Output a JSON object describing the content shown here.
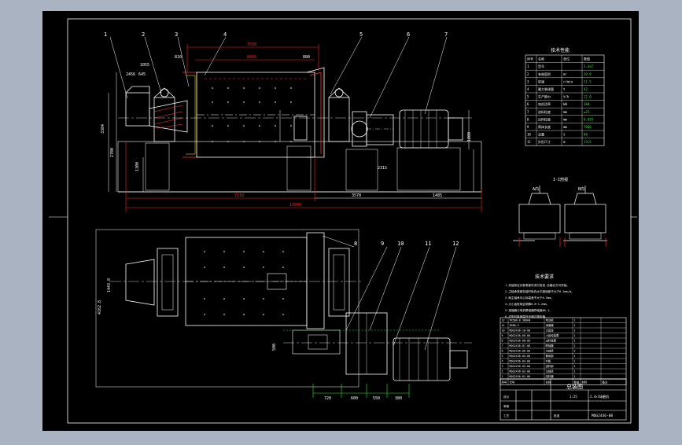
{
  "colors": {
    "viewport_bg": "#a9b3c2",
    "sheet_bg": "#000000",
    "line": "#ffffff",
    "red_dim": "#ff2020",
    "green_dim": "#22ee22",
    "yellow_text": "#ffff00",
    "cyan": "#00e5ff"
  },
  "callouts_top": [
    "1",
    "2",
    "3",
    "4",
    "5",
    "6",
    "7"
  ],
  "callouts_bottom": [
    "8",
    "9",
    "10",
    "11",
    "12"
  ],
  "dims_top": {
    "d7550": "7550",
    "d6800": "6800",
    "d7218": "7218",
    "d13090": "13090",
    "d3570": "3570",
    "d1485": "1485",
    "d1055": "1055",
    "d810": "810",
    "d880": "880",
    "d2315": "2315",
    "d1300": "1300",
    "d1000": "1000",
    "d3384": "3384",
    "d2700": "2700",
    "d645": "645",
    "d2456": "2456"
  },
  "dims_bottom": {
    "d4162": "4162.8",
    "d1443": "1443.8",
    "d500": "500",
    "d720": "720",
    "d600": "600",
    "d550": "550",
    "d380": "380"
  },
  "tech_table": {
    "title": "技术性能",
    "headers": [
      "序号",
      "名称",
      "单位",
      "数值"
    ],
    "rows": [
      [
        "1",
        "型号",
        "",
        "2.4×7"
      ],
      [
        "2",
        "有效容积",
        "m³",
        "28.9"
      ],
      [
        "3",
        "转速",
        "r/min",
        "21.5"
      ],
      [
        "4",
        "最大装球量",
        "t",
        "42"
      ],
      [
        "5",
        "生产能力",
        "t/h",
        "12.0"
      ],
      [
        "6",
        "电机功率",
        "kW",
        "380"
      ],
      [
        "7",
        "进料粒度",
        "mm",
        "≤25"
      ],
      [
        "8",
        "出料粒度",
        "mm",
        "0.074"
      ],
      [
        "9",
        "筒体长度",
        "mm",
        "7000"
      ],
      [
        "10",
        "总重",
        "t",
        "88"
      ],
      [
        "11",
        "外形尺寸",
        "m",
        "13×5"
      ]
    ]
  },
  "detail_label": "I-I剖视",
  "detail_marks": [
    "A向",
    "B向"
  ],
  "notes": {
    "title": "技术要求",
    "lines": [
      "1.安装前应对各零部件进行检查,合格后方可安装。",
      "2.主轴承底座安装时纵向水平度误差不大于0.1mm/m。",
      "3.两主轴承中心标高差不大于0.5mm。",
      "4.大小齿轮啮合侧隙0.8~1.2mm。",
      "5.减速器与电机联轴器同轴度Φ0.1。",
      "6.试车时各部温升不超过规定值。"
    ]
  },
  "parts_list": {
    "rows": [
      [
        "12",
        "YR500-8 380kW",
        "电动机",
        "1",
        "",
        ""
      ],
      [
        "11",
        "ZD80-5",
        "减速器",
        "1",
        "",
        ""
      ],
      [
        "10",
        "MQG2436-10-00",
        "大齿轮",
        "1",
        "",
        ""
      ],
      [
        "9",
        "MQG2436-09-00",
        "小齿轮装置",
        "1",
        "",
        ""
      ],
      [
        "8",
        "MQG2436-08-00",
        "出料装置",
        "1",
        "",
        ""
      ],
      [
        "7",
        "MQG2436-07-00",
        "联轴器",
        "1",
        "",
        ""
      ],
      [
        "6",
        "MQG2436-06-00",
        "主轴承",
        "2",
        "",
        ""
      ],
      [
        "5",
        "MQG2436-05-00",
        "筒体部",
        "1",
        "",
        ""
      ],
      [
        "4",
        "MQG2436-04-00",
        "衬板",
        "1",
        "",
        ""
      ],
      [
        "3",
        "MQG2436-03-00",
        "进料部",
        "1",
        "",
        ""
      ],
      [
        "2",
        "MQG2436-02-00",
        "主轴承",
        "1",
        "",
        ""
      ],
      [
        "1",
        "MQG2436-01-00",
        "给料器",
        "1",
        "",
        ""
      ]
    ],
    "header": [
      "序号",
      "代号",
      "名称",
      "数量",
      "材料",
      "备注"
    ]
  },
  "title_block": {
    "drawing_title": "总装图",
    "subtitle": "2.4×7球磨机",
    "drawing_no": "MQG2436-00",
    "scale": "1:25",
    "labels": [
      "设计",
      "审核",
      "工艺",
      "批准"
    ]
  }
}
